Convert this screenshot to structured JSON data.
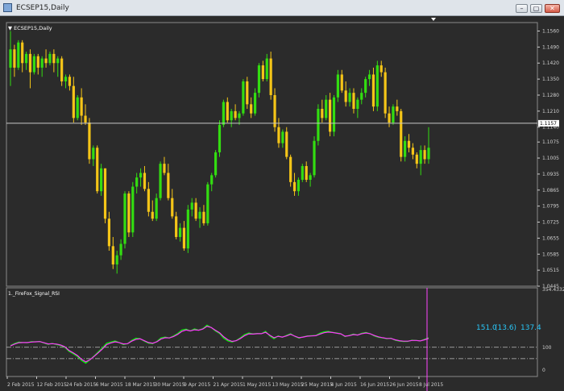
{
  "window": {
    "title": "ECSEP15,Daily",
    "buttons": [
      "–",
      "▢",
      "✕"
    ]
  },
  "colors": {
    "background": "#2b2b2b",
    "bull": "#33dd11",
    "bear": "#f5c518",
    "axis": "#cfcfcf",
    "rsi_line": "#00ff00",
    "signal_line": "#ff33ff",
    "cursor_line": "#ff44ff",
    "readout": "#29c5f6"
  },
  "chart_data": [
    {
      "type": "candlestick",
      "title": "ECSEP15,Daily",
      "ylim": [
        1.0445,
        1.1597
      ],
      "y_ticks": [
        "1.1560",
        "1.1490",
        "1.1420",
        "1.1350",
        "1.1280",
        "1.1210",
        "1.1140",
        "1.1075",
        "1.1005",
        "1.0935",
        "1.0865",
        "1.0795",
        "1.0725",
        "1.0655",
        "1.0585",
        "1.0515",
        "1.0445"
      ],
      "current_price": "1.1157",
      "candles": [
        [
          1.14,
          1.156,
          1.132,
          1.148
        ],
        [
          1.148,
          1.15,
          1.136,
          1.14
        ],
        [
          1.14,
          1.152,
          1.139,
          1.151
        ],
        [
          1.151,
          1.152,
          1.138,
          1.142
        ],
        [
          1.142,
          1.147,
          1.139,
          1.146
        ],
        [
          1.146,
          1.148,
          1.131,
          1.138
        ],
        [
          1.138,
          1.146,
          1.137,
          1.145
        ],
        [
          1.145,
          1.146,
          1.137,
          1.14
        ],
        [
          1.14,
          1.145,
          1.136,
          1.144
        ],
        [
          1.144,
          1.148,
          1.14,
          1.142
        ],
        [
          1.142,
          1.147,
          1.141,
          1.146
        ],
        [
          1.146,
          1.148,
          1.138,
          1.142
        ],
        [
          1.142,
          1.145,
          1.136,
          1.144
        ],
        [
          1.144,
          1.145,
          1.132,
          1.134
        ],
        [
          1.134,
          1.137,
          1.131,
          1.136
        ],
        [
          1.136,
          1.137,
          1.13,
          1.132
        ],
        [
          1.132,
          1.136,
          1.116,
          1.118
        ],
        [
          1.118,
          1.128,
          1.117,
          1.127
        ],
        [
          1.127,
          1.131,
          1.115,
          1.119
        ],
        [
          1.119,
          1.124,
          1.115,
          1.116
        ],
        [
          1.116,
          1.118,
          1.098,
          1.1
        ],
        [
          1.1,
          1.106,
          1.097,
          1.105
        ],
        [
          1.105,
          1.106,
          1.085,
          1.086
        ],
        [
          1.086,
          1.098,
          1.084,
          1.096
        ],
        [
          1.096,
          1.096,
          1.072,
          1.074
        ],
        [
          1.074,
          1.077,
          1.06,
          1.062
        ],
        [
          1.062,
          1.066,
          1.052,
          1.054
        ],
        [
          1.054,
          1.06,
          1.05,
          1.058
        ],
        [
          1.058,
          1.065,
          1.056,
          1.063
        ],
        [
          1.063,
          1.086,
          1.061,
          1.085
        ],
        [
          1.085,
          1.086,
          1.066,
          1.068
        ],
        [
          1.068,
          1.09,
          1.066,
          1.088
        ],
        [
          1.088,
          1.094,
          1.085,
          1.092
        ],
        [
          1.092,
          1.096,
          1.088,
          1.094
        ],
        [
          1.094,
          1.097,
          1.086,
          1.087
        ],
        [
          1.087,
          1.09,
          1.075,
          1.077
        ],
        [
          1.077,
          1.082,
          1.073,
          1.074
        ],
        [
          1.074,
          1.085,
          1.073,
          1.083
        ],
        [
          1.083,
          1.099,
          1.082,
          1.098
        ],
        [
          1.098,
          1.101,
          1.093,
          1.094
        ],
        [
          1.094,
          1.098,
          1.082,
          1.083
        ],
        [
          1.083,
          1.087,
          1.074,
          1.075
        ],
        [
          1.075,
          1.077,
          1.065,
          1.066
        ],
        [
          1.066,
          1.072,
          1.064,
          1.07
        ],
        [
          1.07,
          1.073,
          1.06,
          1.061
        ],
        [
          1.061,
          1.08,
          1.059,
          1.078
        ],
        [
          1.078,
          1.083,
          1.075,
          1.081
        ],
        [
          1.081,
          1.083,
          1.073,
          1.074
        ],
        [
          1.074,
          1.079,
          1.07,
          1.077
        ],
        [
          1.077,
          1.08,
          1.071,
          1.072
        ],
        [
          1.072,
          1.09,
          1.071,
          1.089
        ],
        [
          1.089,
          1.094,
          1.086,
          1.093
        ],
        [
          1.093,
          1.104,
          1.092,
          1.103
        ],
        [
          1.103,
          1.117,
          1.101,
          1.115
        ],
        [
          1.115,
          1.126,
          1.114,
          1.125
        ],
        [
          1.125,
          1.127,
          1.116,
          1.117
        ],
        [
          1.117,
          1.122,
          1.114,
          1.121
        ],
        [
          1.121,
          1.124,
          1.117,
          1.118
        ],
        [
          1.118,
          1.121,
          1.115,
          1.12
        ],
        [
          1.12,
          1.135,
          1.119,
          1.134
        ],
        [
          1.134,
          1.136,
          1.122,
          1.124
        ],
        [
          1.124,
          1.127,
          1.118,
          1.12
        ],
        [
          1.12,
          1.131,
          1.119,
          1.129
        ],
        [
          1.129,
          1.142,
          1.127,
          1.141
        ],
        [
          1.141,
          1.143,
          1.134,
          1.135
        ],
        [
          1.135,
          1.146,
          1.134,
          1.144
        ],
        [
          1.144,
          1.147,
          1.126,
          1.128
        ],
        [
          1.128,
          1.131,
          1.112,
          1.114
        ],
        [
          1.114,
          1.118,
          1.105,
          1.107
        ],
        [
          1.107,
          1.113,
          1.105,
          1.112
        ],
        [
          1.112,
          1.114,
          1.1,
          1.101
        ],
        [
          1.101,
          1.102,
          1.088,
          1.09
        ],
        [
          1.09,
          1.094,
          1.084,
          1.086
        ],
        [
          1.086,
          1.092,
          1.084,
          1.091
        ],
        [
          1.091,
          1.098,
          1.09,
          1.097
        ],
        [
          1.097,
          1.099,
          1.09,
          1.091
        ],
        [
          1.091,
          1.094,
          1.088,
          1.093
        ],
        [
          1.093,
          1.11,
          1.092,
          1.108
        ],
        [
          1.108,
          1.124,
          1.106,
          1.122
        ],
        [
          1.122,
          1.126,
          1.116,
          1.118
        ],
        [
          1.118,
          1.128,
          1.117,
          1.126
        ],
        [
          1.126,
          1.129,
          1.11,
          1.112
        ],
        [
          1.112,
          1.128,
          1.11,
          1.127
        ],
        [
          1.127,
          1.139,
          1.125,
          1.137
        ],
        [
          1.137,
          1.139,
          1.129,
          1.13
        ],
        [
          1.13,
          1.134,
          1.123,
          1.125
        ],
        [
          1.125,
          1.131,
          1.123,
          1.129
        ],
        [
          1.129,
          1.131,
          1.12,
          1.122
        ],
        [
          1.122,
          1.127,
          1.118,
          1.126
        ],
        [
          1.126,
          1.131,
          1.124,
          1.129
        ],
        [
          1.129,
          1.136,
          1.127,
          1.135
        ],
        [
          1.135,
          1.139,
          1.132,
          1.137
        ],
        [
          1.137,
          1.14,
          1.121,
          1.123
        ],
        [
          1.123,
          1.143,
          1.121,
          1.141
        ],
        [
          1.141,
          1.143,
          1.136,
          1.138
        ],
        [
          1.138,
          1.14,
          1.118,
          1.12
        ],
        [
          1.12,
          1.123,
          1.114,
          1.116
        ],
        [
          1.116,
          1.124,
          1.115,
          1.123
        ],
        [
          1.123,
          1.126,
          1.119,
          1.121
        ],
        [
          1.121,
          1.122,
          1.099,
          1.101
        ],
        [
          1.101,
          1.11,
          1.099,
          1.108
        ],
        [
          1.108,
          1.111,
          1.103,
          1.105
        ],
        [
          1.105,
          1.107,
          1.1,
          1.102
        ],
        [
          1.102,
          1.103,
          1.096,
          1.098
        ],
        [
          1.098,
          1.106,
          1.093,
          1.104
        ],
        [
          1.104,
          1.106,
          1.098,
          1.1
        ],
        [
          1.1,
          1.114,
          1.098,
          1.105
        ]
      ]
    },
    {
      "type": "line",
      "title": "1._FireFox_Signal_RSI",
      "ylim": [
        0,
        354.4332
      ],
      "y_ticks": [
        "354.4332",
        "100",
        "0"
      ],
      "reference_lines": [
        100,
        50
      ],
      "readout": {
        "v1": "151.0",
        "v2": "(13.6)",
        "v3": "137.4"
      },
      "x_tick_labels": [
        "2 Feb 2015",
        "12 Feb 2015",
        "24 Feb 2015",
        "6 Mar 2015",
        "18 Mar 2015",
        "30 Mar 2015",
        "9 Apr 2015",
        "21 Apr 2015",
        "1 May 2015",
        "13 May 2015",
        "25 May 2015",
        "4 Jun 2015",
        "16 Jun 2015",
        "26 Jun 2015",
        "8 Jul 2015"
      ],
      "series": [
        {
          "values": [
            108,
            117,
            123,
            121,
            120,
            125,
            124,
            126,
            119,
            113,
            117,
            112,
            108,
            100,
            82,
            72,
            60,
            42,
            30,
            45,
            62,
            80,
            98,
            118,
            123,
            128,
            121,
            112,
            116,
            130,
            140,
            138,
            127,
            118,
            116,
            126,
            141,
            145,
            141,
            150,
            161,
            176,
            180,
            172,
            181,
            175,
            182,
            197,
            187,
            172,
            161,
            140,
            128,
            123,
            130,
            142,
            156,
            163,
            159,
            161,
            160,
            170,
            150,
            138,
            150,
            144,
            152,
            160,
            148,
            140,
            146,
            150,
            151,
            152,
            162,
            168,
            170,
            166,
            163,
            160,
            147,
            152,
            158,
            154,
            162,
            165,
            160,
            150,
            144,
            141,
            138,
            140,
            131,
            127,
            125,
            126,
            131,
            130,
            128,
            135,
            142
          ]
        },
        {
          "values": [
            106,
            114,
            120,
            121,
            121,
            123,
            124,
            125,
            120,
            115,
            116,
            114,
            110,
            102,
            86,
            76,
            64,
            47,
            36,
            45,
            60,
            76,
            93,
            112,
            119,
            124,
            121,
            115,
            116,
            127,
            135,
            137,
            129,
            121,
            118,
            124,
            136,
            142,
            141,
            147,
            157,
            170,
            176,
            172,
            177,
            175,
            180,
            192,
            187,
            175,
            164,
            146,
            133,
            126,
            129,
            139,
            151,
            159,
            158,
            160,
            160,
            166,
            153,
            142,
            148,
            145,
            150,
            157,
            149,
            142,
            145,
            149,
            150,
            151,
            158,
            164,
            167,
            165,
            162,
            159,
            149,
            151,
            156,
            154,
            160,
            163,
            160,
            152,
            146,
            142,
            139,
            139,
            133,
            129,
            127,
            127,
            130,
            130,
            128,
            133,
            139
          ]
        }
      ]
    }
  ]
}
